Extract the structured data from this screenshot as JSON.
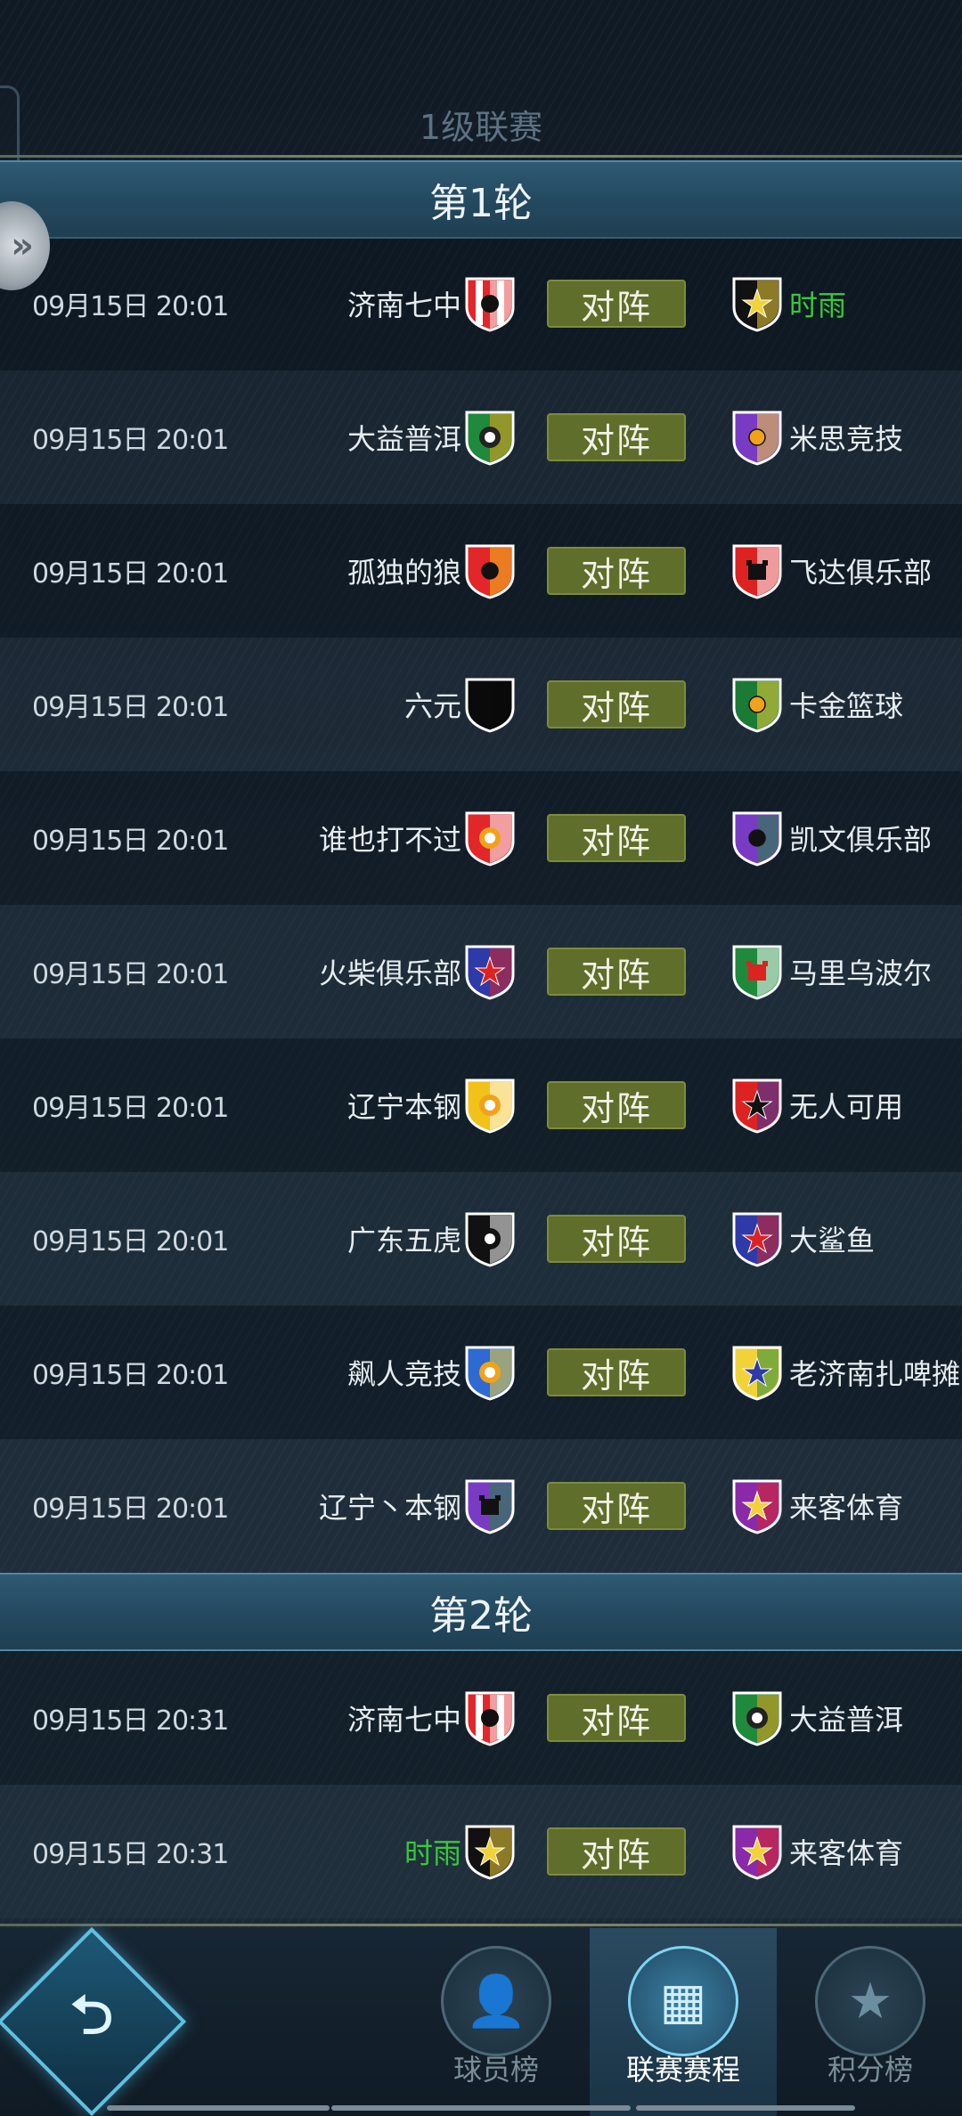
{
  "league_title": "1级联赛",
  "rounds": [
    {
      "label": "第1轮"
    },
    {
      "label": "第2轮"
    }
  ],
  "vs_label": "对阵",
  "matches": [
    {
      "time": "09月15日  20:01",
      "home": "济南七中",
      "away": "时雨",
      "home_badge": "red-white-stripe-shield",
      "away_badge": "yellow-star-shield",
      "away_highlight": true,
      "home_highlight": false
    },
    {
      "time": "09月15日  20:01",
      "home": "大益普洱",
      "away": "米思竞技",
      "home_badge": "green-lion-shield",
      "away_badge": "purple-ball-banner",
      "away_highlight": false,
      "home_highlight": false
    },
    {
      "time": "09月15日  20:01",
      "home": "孤独的狼",
      "away": "飞达俱乐部",
      "home_badge": "red-yellow-ball-banner",
      "away_badge": "red-white-castle-shield",
      "away_highlight": false,
      "home_highlight": false
    },
    {
      "time": "09月15日  20:01",
      "home": "六元",
      "away": "卡金篮球",
      "home_badge": "black-plain-shield",
      "away_badge": "green-ball-banner",
      "away_highlight": false,
      "home_highlight": false
    },
    {
      "time": "09月15日  20:01",
      "home": "谁也打不过",
      "away": "凯文俱乐部",
      "home_badge": "red-white-lion-shield",
      "away_badge": "purple-green-ball-banner",
      "away_highlight": false,
      "home_highlight": false
    },
    {
      "time": "09月15日  20:01",
      "home": "火柴俱乐部",
      "away": "马里乌波尔",
      "home_badge": "blue-star-shield",
      "away_badge": "green-white-castle-banner",
      "away_highlight": false,
      "home_highlight": false
    },
    {
      "time": "09月15日  20:01",
      "home": "辽宁本钢",
      "away": "无人可用",
      "home_badge": "yellow-lion-shield",
      "away_badge": "red-blue-star-circle",
      "away_highlight": false,
      "home_highlight": false
    },
    {
      "time": "09月15日  20:01",
      "home": "广东五虎",
      "away": "大鲨鱼",
      "home_badge": "black-white-lion-shield",
      "away_badge": "blue-star-shield",
      "away_highlight": false,
      "home_highlight": false
    },
    {
      "time": "09月15日  20:01",
      "home": "飙人竞技",
      "away": "老济南扎啤摊",
      "home_badge": "blue-yellow-lion-shield",
      "away_badge": "yellow-green-star-banner",
      "away_highlight": false,
      "home_highlight": false
    },
    {
      "time": "09月15日  20:01",
      "home": "辽宁丶本钢",
      "away": "来客体育",
      "home_badge": "green-castle-shield",
      "away_badge": "red-purple-star-shield",
      "away_highlight": false,
      "home_highlight": false
    },
    {
      "time": "09月15日  20:31",
      "home": "济南七中",
      "away": "大益普洱",
      "home_badge": "red-white-stripe-shield",
      "away_badge": "green-lion-shield",
      "away_highlight": false,
      "home_highlight": false
    },
    {
      "time": "09月15日  20:31",
      "home": "时雨",
      "away": "来客体育",
      "home_badge": "yellow-star-shield",
      "away_badge": "red-purple-star-shield",
      "away_highlight": false,
      "home_highlight": true
    }
  ],
  "nav": {
    "back_icon": "back-arrow-icon",
    "items": [
      {
        "label": "球员榜",
        "icon": "player-icon",
        "active": false
      },
      {
        "label": "联赛赛程",
        "icon": "calendar-icon",
        "active": true
      },
      {
        "label": "积分榜",
        "icon": "star-trophy-icon",
        "active": false
      }
    ]
  },
  "colors": {
    "highlight_green": "#36c93a",
    "vs_button": "#5f6e2b",
    "round_bar": "#2b5269"
  }
}
